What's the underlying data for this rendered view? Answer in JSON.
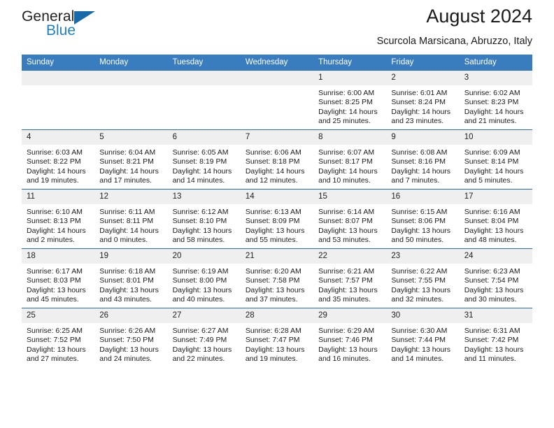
{
  "brand": {
    "name_part1": "General",
    "name_part2": "Blue",
    "triangle_color": "#1769aa"
  },
  "header": {
    "title": "August 2024",
    "subtitle": "Scurcola Marsicana, Abruzzo, Italy",
    "header_bg_color": "#3a7dbf",
    "row_border_color": "#2e6da4",
    "daynum_bg_color": "#efefef"
  },
  "weekdays": [
    "Sunday",
    "Monday",
    "Tuesday",
    "Wednesday",
    "Thursday",
    "Friday",
    "Saturday"
  ],
  "weeks": [
    [
      {
        "day": "",
        "empty": true
      },
      {
        "day": "",
        "empty": true
      },
      {
        "day": "",
        "empty": true
      },
      {
        "day": "",
        "empty": true
      },
      {
        "day": "1",
        "sunrise": "Sunrise: 6:00 AM",
        "sunset": "Sunset: 8:25 PM",
        "daylight": "Daylight: 14 hours and 25 minutes."
      },
      {
        "day": "2",
        "sunrise": "Sunrise: 6:01 AM",
        "sunset": "Sunset: 8:24 PM",
        "daylight": "Daylight: 14 hours and 23 minutes."
      },
      {
        "day": "3",
        "sunrise": "Sunrise: 6:02 AM",
        "sunset": "Sunset: 8:23 PM",
        "daylight": "Daylight: 14 hours and 21 minutes."
      }
    ],
    [
      {
        "day": "4",
        "sunrise": "Sunrise: 6:03 AM",
        "sunset": "Sunset: 8:22 PM",
        "daylight": "Daylight: 14 hours and 19 minutes."
      },
      {
        "day": "5",
        "sunrise": "Sunrise: 6:04 AM",
        "sunset": "Sunset: 8:21 PM",
        "daylight": "Daylight: 14 hours and 17 minutes."
      },
      {
        "day": "6",
        "sunrise": "Sunrise: 6:05 AM",
        "sunset": "Sunset: 8:19 PM",
        "daylight": "Daylight: 14 hours and 14 minutes."
      },
      {
        "day": "7",
        "sunrise": "Sunrise: 6:06 AM",
        "sunset": "Sunset: 8:18 PM",
        "daylight": "Daylight: 14 hours and 12 minutes."
      },
      {
        "day": "8",
        "sunrise": "Sunrise: 6:07 AM",
        "sunset": "Sunset: 8:17 PM",
        "daylight": "Daylight: 14 hours and 10 minutes."
      },
      {
        "day": "9",
        "sunrise": "Sunrise: 6:08 AM",
        "sunset": "Sunset: 8:16 PM",
        "daylight": "Daylight: 14 hours and 7 minutes."
      },
      {
        "day": "10",
        "sunrise": "Sunrise: 6:09 AM",
        "sunset": "Sunset: 8:14 PM",
        "daylight": "Daylight: 14 hours and 5 minutes."
      }
    ],
    [
      {
        "day": "11",
        "sunrise": "Sunrise: 6:10 AM",
        "sunset": "Sunset: 8:13 PM",
        "daylight": "Daylight: 14 hours and 2 minutes."
      },
      {
        "day": "12",
        "sunrise": "Sunrise: 6:11 AM",
        "sunset": "Sunset: 8:11 PM",
        "daylight": "Daylight: 14 hours and 0 minutes."
      },
      {
        "day": "13",
        "sunrise": "Sunrise: 6:12 AM",
        "sunset": "Sunset: 8:10 PM",
        "daylight": "Daylight: 13 hours and 58 minutes."
      },
      {
        "day": "14",
        "sunrise": "Sunrise: 6:13 AM",
        "sunset": "Sunset: 8:09 PM",
        "daylight": "Daylight: 13 hours and 55 minutes."
      },
      {
        "day": "15",
        "sunrise": "Sunrise: 6:14 AM",
        "sunset": "Sunset: 8:07 PM",
        "daylight": "Daylight: 13 hours and 53 minutes."
      },
      {
        "day": "16",
        "sunrise": "Sunrise: 6:15 AM",
        "sunset": "Sunset: 8:06 PM",
        "daylight": "Daylight: 13 hours and 50 minutes."
      },
      {
        "day": "17",
        "sunrise": "Sunrise: 6:16 AM",
        "sunset": "Sunset: 8:04 PM",
        "daylight": "Daylight: 13 hours and 48 minutes."
      }
    ],
    [
      {
        "day": "18",
        "sunrise": "Sunrise: 6:17 AM",
        "sunset": "Sunset: 8:03 PM",
        "daylight": "Daylight: 13 hours and 45 minutes."
      },
      {
        "day": "19",
        "sunrise": "Sunrise: 6:18 AM",
        "sunset": "Sunset: 8:01 PM",
        "daylight": "Daylight: 13 hours and 43 minutes."
      },
      {
        "day": "20",
        "sunrise": "Sunrise: 6:19 AM",
        "sunset": "Sunset: 8:00 PM",
        "daylight": "Daylight: 13 hours and 40 minutes."
      },
      {
        "day": "21",
        "sunrise": "Sunrise: 6:20 AM",
        "sunset": "Sunset: 7:58 PM",
        "daylight": "Daylight: 13 hours and 37 minutes."
      },
      {
        "day": "22",
        "sunrise": "Sunrise: 6:21 AM",
        "sunset": "Sunset: 7:57 PM",
        "daylight": "Daylight: 13 hours and 35 minutes."
      },
      {
        "day": "23",
        "sunrise": "Sunrise: 6:22 AM",
        "sunset": "Sunset: 7:55 PM",
        "daylight": "Daylight: 13 hours and 32 minutes."
      },
      {
        "day": "24",
        "sunrise": "Sunrise: 6:23 AM",
        "sunset": "Sunset: 7:54 PM",
        "daylight": "Daylight: 13 hours and 30 minutes."
      }
    ],
    [
      {
        "day": "25",
        "sunrise": "Sunrise: 6:25 AM",
        "sunset": "Sunset: 7:52 PM",
        "daylight": "Daylight: 13 hours and 27 minutes."
      },
      {
        "day": "26",
        "sunrise": "Sunrise: 6:26 AM",
        "sunset": "Sunset: 7:50 PM",
        "daylight": "Daylight: 13 hours and 24 minutes."
      },
      {
        "day": "27",
        "sunrise": "Sunrise: 6:27 AM",
        "sunset": "Sunset: 7:49 PM",
        "daylight": "Daylight: 13 hours and 22 minutes."
      },
      {
        "day": "28",
        "sunrise": "Sunrise: 6:28 AM",
        "sunset": "Sunset: 7:47 PM",
        "daylight": "Daylight: 13 hours and 19 minutes."
      },
      {
        "day": "29",
        "sunrise": "Sunrise: 6:29 AM",
        "sunset": "Sunset: 7:46 PM",
        "daylight": "Daylight: 13 hours and 16 minutes."
      },
      {
        "day": "30",
        "sunrise": "Sunrise: 6:30 AM",
        "sunset": "Sunset: 7:44 PM",
        "daylight": "Daylight: 13 hours and 14 minutes."
      },
      {
        "day": "31",
        "sunrise": "Sunrise: 6:31 AM",
        "sunset": "Sunset: 7:42 PM",
        "daylight": "Daylight: 13 hours and 11 minutes."
      }
    ]
  ]
}
